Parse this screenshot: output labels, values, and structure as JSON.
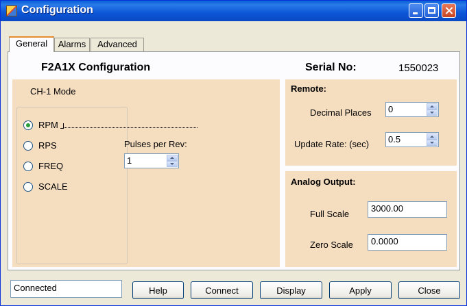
{
  "window": {
    "title": "Configuration"
  },
  "tabs": [
    {
      "label": "General",
      "active": true
    },
    {
      "label": "Alarms",
      "active": false
    },
    {
      "label": "Advanced",
      "active": false
    }
  ],
  "general": {
    "heading": "F2A1X Configuration",
    "serial_label": "Serial No:",
    "serial_value": "1550023",
    "ch1": {
      "label": "CH-1 Mode",
      "options": [
        {
          "label": "RPM",
          "checked": true
        },
        {
          "label": "RPS",
          "checked": false
        },
        {
          "label": "FREQ",
          "checked": false
        },
        {
          "label": "SCALE",
          "checked": false
        }
      ],
      "pulses_label": "Pulses per Rev:",
      "pulses_value": "1"
    },
    "remote": {
      "title": "Remote:",
      "decimal_label": "Decimal Places",
      "decimal_value": "0",
      "update_label": "Update Rate: (sec)",
      "update_value": "0.5"
    },
    "analog": {
      "title": "Analog Output:",
      "full_label": "Full Scale",
      "full_value": "3000.00",
      "zero_label": "Zero Scale",
      "zero_value": "0.0000"
    }
  },
  "status_text": "Connected",
  "buttons": {
    "help": "Help",
    "connect": "Connect",
    "display": "Display",
    "apply": "Apply",
    "close": "Close"
  },
  "colors": {
    "titlebar": "#0a5fd8",
    "panel_group": "#f5ddc0",
    "radio_checked": "#2a9d3b"
  }
}
